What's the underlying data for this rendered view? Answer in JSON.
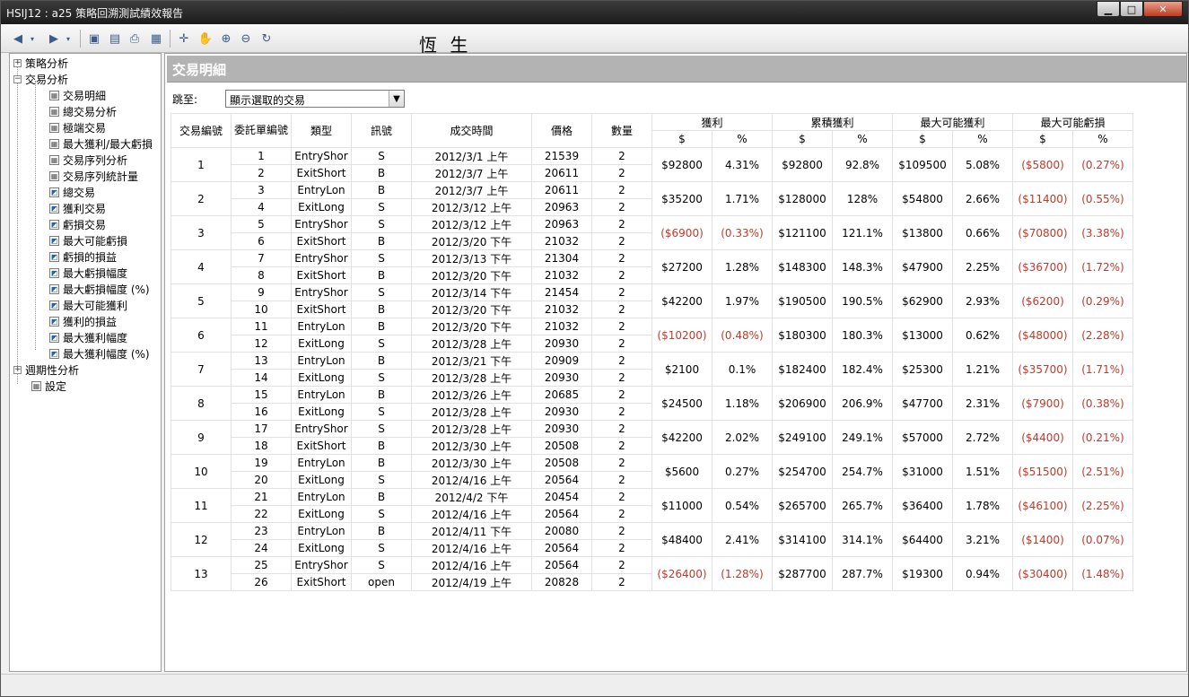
{
  "window": {
    "title": "HSIJ12 : a25 策略回溯測試績效報告"
  },
  "toolbar": {
    "brand": "恆  生"
  },
  "sidebar": {
    "groups": [
      {
        "label": "策略分析",
        "expander": "+"
      },
      {
        "label": "交易分析",
        "expander": "−"
      }
    ],
    "items": [
      {
        "label": "交易明細",
        "icon": "table-icon"
      },
      {
        "label": "總交易分析",
        "icon": "table-icon"
      },
      {
        "label": "極端交易",
        "icon": "table-icon"
      },
      {
        "label": "最大獲利/最大虧損",
        "icon": "table-icon"
      },
      {
        "label": "交易序列分析",
        "icon": "table-icon"
      },
      {
        "label": "交易序列統計量",
        "icon": "table-icon"
      },
      {
        "label": "總交易",
        "icon": "chart-icon"
      },
      {
        "label": "獲利交易",
        "icon": "chart-icon"
      },
      {
        "label": "虧損交易",
        "icon": "chart-icon"
      },
      {
        "label": "最大可能虧損",
        "icon": "chart-icon"
      },
      {
        "label": "虧損的損益",
        "icon": "chart-icon"
      },
      {
        "label": "最大虧損幅度",
        "icon": "chart-icon"
      },
      {
        "label": "最大虧損幅度 (%)",
        "icon": "chart-icon"
      },
      {
        "label": "最大可能獲利",
        "icon": "chart-icon"
      },
      {
        "label": "獲利的損益",
        "icon": "chart-icon"
      },
      {
        "label": "最大獲利幅度",
        "icon": "chart-icon"
      },
      {
        "label": "最大獲利幅度 (%)",
        "icon": "chart-icon"
      }
    ],
    "tail": [
      {
        "label": "週期性分析",
        "expander": "+"
      },
      {
        "label": "設定",
        "icon": "table-icon"
      }
    ]
  },
  "main": {
    "header": "交易明細",
    "jump_label": "跳至:",
    "jump_value": "顯示選取的交易",
    "columns": {
      "trade_no": "交易編號",
      "order_no": "委託單編號",
      "type": "類型",
      "signal": "訊號",
      "time": "成交時間",
      "price": "價格",
      "qty": "數量",
      "profit": "獲利",
      "cum_profit": "累積獲利",
      "max_profit": "最大可能獲利",
      "max_loss": "最大可能虧損",
      "dollar": "$",
      "pct": "%"
    },
    "trades": [
      {
        "no": "1",
        "o1": "1",
        "t1": "EntryShor",
        "s1": "S",
        "d1": "2012/3/1 上午",
        "p1": "21539",
        "q1": "2",
        "o2": "2",
        "t2": "ExitShort",
        "s2": "B",
        "d2": "2012/3/7 上午",
        "p2": "20611",
        "q2": "2",
        "pd": "$92800",
        "pp": "4.31%",
        "cd": "$92800",
        "cp": "92.8%",
        "md": "$109500",
        "mp": "5.08%",
        "ld": "($5800)",
        "lp": "(0.27%)"
      },
      {
        "no": "2",
        "o1": "3",
        "t1": "EntryLon",
        "s1": "B",
        "d1": "2012/3/7 上午",
        "p1": "20611",
        "q1": "2",
        "o2": "4",
        "t2": "ExitLong",
        "s2": "S",
        "d2": "2012/3/12 上午",
        "p2": "20963",
        "q2": "2",
        "pd": "$35200",
        "pp": "1.71%",
        "cd": "$128000",
        "cp": "128%",
        "md": "$54800",
        "mp": "2.66%",
        "ld": "($11400)",
        "lp": "(0.55%)"
      },
      {
        "no": "3",
        "o1": "5",
        "t1": "EntryShor",
        "s1": "S",
        "d1": "2012/3/12 上午",
        "p1": "20963",
        "q1": "2",
        "o2": "6",
        "t2": "ExitShort",
        "s2": "B",
        "d2": "2012/3/20 下午",
        "p2": "21032",
        "q2": "2",
        "pd": "($6900)",
        "pp": "(0.33%)",
        "cd": "$121100",
        "cp": "121.1%",
        "md": "$13800",
        "mp": "0.66%",
        "ld": "($70800)",
        "lp": "(3.38%)"
      },
      {
        "no": "4",
        "o1": "7",
        "t1": "EntryShor",
        "s1": "S",
        "d1": "2012/3/13 下午",
        "p1": "21304",
        "q1": "2",
        "o2": "8",
        "t2": "ExitShort",
        "s2": "B",
        "d2": "2012/3/20 下午",
        "p2": "21032",
        "q2": "2",
        "pd": "$27200",
        "pp": "1.28%",
        "cd": "$148300",
        "cp": "148.3%",
        "md": "$47900",
        "mp": "2.25%",
        "ld": "($36700)",
        "lp": "(1.72%)"
      },
      {
        "no": "5",
        "o1": "9",
        "t1": "EntryShor",
        "s1": "S",
        "d1": "2012/3/14 下午",
        "p1": "21454",
        "q1": "2",
        "o2": "10",
        "t2": "ExitShort",
        "s2": "B",
        "d2": "2012/3/20 下午",
        "p2": "21032",
        "q2": "2",
        "pd": "$42200",
        "pp": "1.97%",
        "cd": "$190500",
        "cp": "190.5%",
        "md": "$62900",
        "mp": "2.93%",
        "ld": "($6200)",
        "lp": "(0.29%)"
      },
      {
        "no": "6",
        "o1": "11",
        "t1": "EntryLon",
        "s1": "B",
        "d1": "2012/3/20 下午",
        "p1": "21032",
        "q1": "2",
        "o2": "12",
        "t2": "ExitLong",
        "s2": "S",
        "d2": "2012/3/28 上午",
        "p2": "20930",
        "q2": "2",
        "pd": "($10200)",
        "pp": "(0.48%)",
        "cd": "$180300",
        "cp": "180.3%",
        "md": "$13000",
        "mp": "0.62%",
        "ld": "($48000)",
        "lp": "(2.28%)"
      },
      {
        "no": "7",
        "o1": "13",
        "t1": "EntryLon",
        "s1": "B",
        "d1": "2012/3/21 下午",
        "p1": "20909",
        "q1": "2",
        "o2": "14",
        "t2": "ExitLong",
        "s2": "S",
        "d2": "2012/3/28 上午",
        "p2": "20930",
        "q2": "2",
        "pd": "$2100",
        "pp": "0.1%",
        "cd": "$182400",
        "cp": "182.4%",
        "md": "$25300",
        "mp": "1.21%",
        "ld": "($35700)",
        "lp": "(1.71%)"
      },
      {
        "no": "8",
        "o1": "15",
        "t1": "EntryLon",
        "s1": "B",
        "d1": "2012/3/26 上午",
        "p1": "20685",
        "q1": "2",
        "o2": "16",
        "t2": "ExitLong",
        "s2": "S",
        "d2": "2012/3/28 上午",
        "p2": "20930",
        "q2": "2",
        "pd": "$24500",
        "pp": "1.18%",
        "cd": "$206900",
        "cp": "206.9%",
        "md": "$47700",
        "mp": "2.31%",
        "ld": "($7900)",
        "lp": "(0.38%)"
      },
      {
        "no": "9",
        "o1": "17",
        "t1": "EntryShor",
        "s1": "S",
        "d1": "2012/3/28 上午",
        "p1": "20930",
        "q1": "2",
        "o2": "18",
        "t2": "ExitShort",
        "s2": "B",
        "d2": "2012/3/30 上午",
        "p2": "20508",
        "q2": "2",
        "pd": "$42200",
        "pp": "2.02%",
        "cd": "$249100",
        "cp": "249.1%",
        "md": "$57000",
        "mp": "2.72%",
        "ld": "($4400)",
        "lp": "(0.21%)"
      },
      {
        "no": "10",
        "o1": "19",
        "t1": "EntryLon",
        "s1": "B",
        "d1": "2012/3/30 上午",
        "p1": "20508",
        "q1": "2",
        "o2": "20",
        "t2": "ExitLong",
        "s2": "S",
        "d2": "2012/4/16 上午",
        "p2": "20564",
        "q2": "2",
        "pd": "$5600",
        "pp": "0.27%",
        "cd": "$254700",
        "cp": "254.7%",
        "md": "$31000",
        "mp": "1.51%",
        "ld": "($51500)",
        "lp": "(2.51%)"
      },
      {
        "no": "11",
        "o1": "21",
        "t1": "EntryLon",
        "s1": "B",
        "d1": "2012/4/2 下午",
        "p1": "20454",
        "q1": "2",
        "o2": "22",
        "t2": "ExitLong",
        "s2": "S",
        "d2": "2012/4/16 上午",
        "p2": "20564",
        "q2": "2",
        "pd": "$11000",
        "pp": "0.54%",
        "cd": "$265700",
        "cp": "265.7%",
        "md": "$36400",
        "mp": "1.78%",
        "ld": "($46100)",
        "lp": "(2.25%)"
      },
      {
        "no": "12",
        "o1": "23",
        "t1": "EntryLon",
        "s1": "B",
        "d1": "2012/4/11 下午",
        "p1": "20080",
        "q1": "2",
        "o2": "24",
        "t2": "ExitLong",
        "s2": "S",
        "d2": "2012/4/16 上午",
        "p2": "20564",
        "q2": "2",
        "pd": "$48400",
        "pp": "2.41%",
        "cd": "$314100",
        "cp": "314.1%",
        "md": "$64400",
        "mp": "3.21%",
        "ld": "($1400)",
        "lp": "(0.07%)"
      },
      {
        "no": "13",
        "o1": "25",
        "t1": "EntryShor",
        "s1": "S",
        "d1": "2012/4/16 上午",
        "p1": "20564",
        "q1": "2",
        "o2": "26",
        "t2": "ExitShort",
        "s2": "open",
        "d2": "2012/4/19 上午",
        "p2": "20828",
        "q2": "2",
        "pd": "($26400)",
        "pp": "(1.28%)",
        "cd": "$287700",
        "cp": "287.7%",
        "md": "$19300",
        "mp": "0.94%",
        "ld": "($30400)",
        "lp": "(1.48%)"
      }
    ]
  }
}
